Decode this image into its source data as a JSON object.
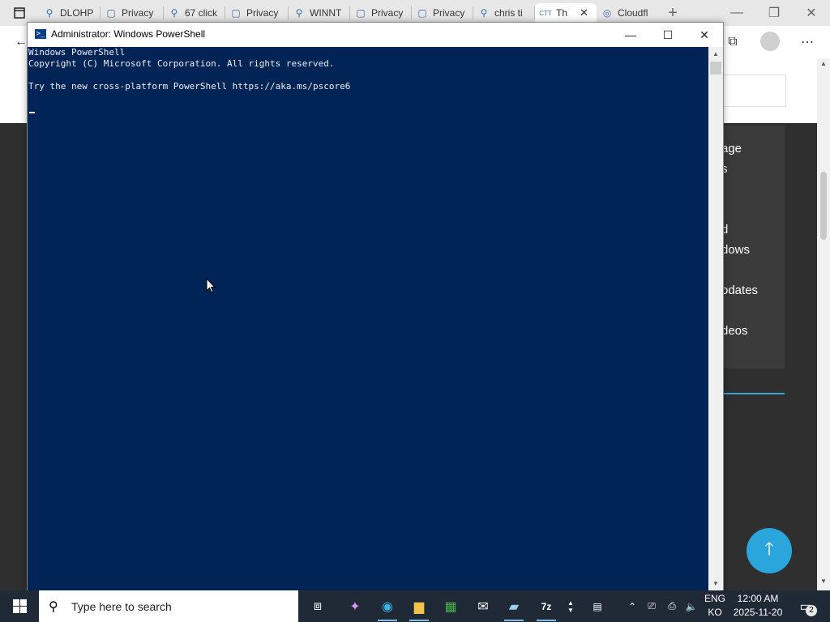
{
  "browser": {
    "tabs": [
      {
        "label": "",
        "icon": "tab-actions-icon"
      },
      {
        "label": "DLOHP",
        "icon": "search-icon"
      },
      {
        "label": "Privacy",
        "icon": "document-lock-icon"
      },
      {
        "label": "67 click",
        "icon": "search-icon"
      },
      {
        "label": "Privacy",
        "icon": "document-lock-icon"
      },
      {
        "label": "WINNT",
        "icon": "search-icon"
      },
      {
        "label": "Privacy",
        "icon": "document-lock-icon"
      },
      {
        "label": "Privacy",
        "icon": "document-lock-icon"
      },
      {
        "label": "chris ti",
        "icon": "search-icon"
      },
      {
        "label": "Th",
        "icon": "site-icon"
      },
      {
        "label": "Cloudfl",
        "icon": "cloudflare-icon"
      }
    ],
    "new_tab_label": "+",
    "page_menu": [
      "age",
      "s",
      "d",
      "dows",
      "odates",
      "deos"
    ]
  },
  "powershell": {
    "title": "Administrator: Windows PowerShell",
    "lines": [
      "Windows PowerShell",
      "Copyright (C) Microsoft Corporation. All rights reserved.",
      "",
      "Try the new cross-platform PowerShell https://aka.ms/pscore6"
    ]
  },
  "taskbar": {
    "search_placeholder": "Type here to search",
    "language_top": "ENG",
    "language_bottom": "KO",
    "time": "12:00 AM",
    "date": "2025-11-20",
    "notification_count": "2"
  },
  "colors": {
    "console_bg": "#012456",
    "console_fg": "#eeedf0",
    "taskbar_bg": "#1f2a36",
    "accent": "#2aa6dc"
  }
}
